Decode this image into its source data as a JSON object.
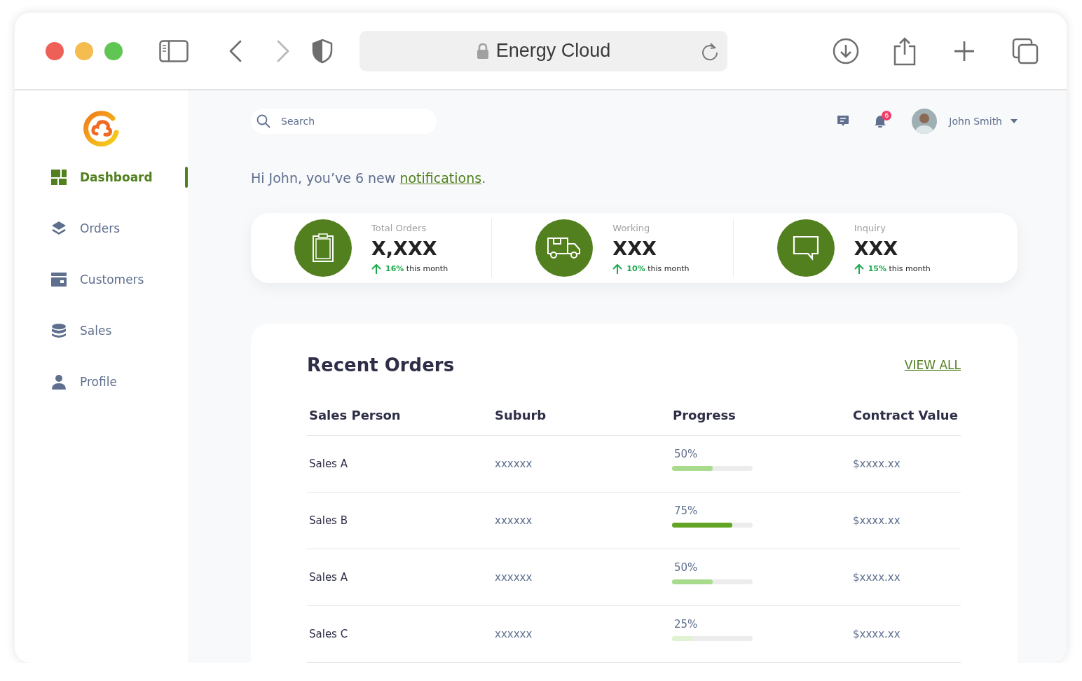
{
  "browser": {
    "title": "Energy Cloud",
    "nav": [
      {
        "kind": "back",
        "disabled": false
      },
      {
        "kind": "forward",
        "disabled": true
      }
    ]
  },
  "sidebar": {
    "items": [
      {
        "kind": "dashboard",
        "label": "Dashboard",
        "selected": true
      },
      {
        "kind": "orders",
        "label": "Orders",
        "selected": false
      },
      {
        "kind": "customers",
        "label": "Customers",
        "selected": false
      },
      {
        "kind": "sales",
        "label": "Sales",
        "selected": false
      },
      {
        "kind": "profile",
        "label": "Profile",
        "selected": false
      }
    ]
  },
  "header": {
    "search": {
      "placeholder": "Search"
    },
    "notification_count": "6",
    "user": {
      "name": "John Smith"
    }
  },
  "greeting": {
    "text": "Hi John, you’ve 6 new",
    "link": "notifications",
    "end": "."
  },
  "stats": [
    {
      "kind": "clipboard",
      "label": "Total Orders",
      "value": "X,XXX",
      "change": "16%",
      "period": "this month"
    },
    {
      "kind": "truck",
      "label": "Working",
      "value": "XXX",
      "change": "10%",
      "period": "this month"
    },
    {
      "kind": "chat",
      "label": "Inquiry",
      "value": "XXX",
      "change": "15%",
      "period": "this month"
    }
  ],
  "orders": {
    "title": "Recent Orders",
    "action": "VIEW ALL",
    "columns": [
      "Sales Person",
      "Suburb",
      "Progress",
      "Contract Value"
    ],
    "rows": [
      {
        "sales_person": "Sales A",
        "suburb": "xxxxxx",
        "progress": {
          "reading": "50%",
          "level": 0.5,
          "color": "#a8dc8c"
        },
        "contract_value": "$xxxx.xx"
      },
      {
        "sales_person": "Sales B",
        "suburb": "xxxxxx",
        "progress": {
          "reading": "75%",
          "level": 0.75,
          "color": "#62a524"
        },
        "contract_value": "$xxxx.xx"
      },
      {
        "sales_person": "Sales A",
        "suburb": "xxxxxx",
        "progress": {
          "reading": "50%",
          "level": 0.5,
          "color": "#a8dc8c"
        },
        "contract_value": "$xxxx.xx"
      },
      {
        "sales_person": "Sales C",
        "suburb": "xxxxxx",
        "progress": {
          "reading": "25%",
          "level": 0.25,
          "color": "#dff3d3"
        },
        "contract_value": "$xxxx.xx"
      }
    ]
  }
}
